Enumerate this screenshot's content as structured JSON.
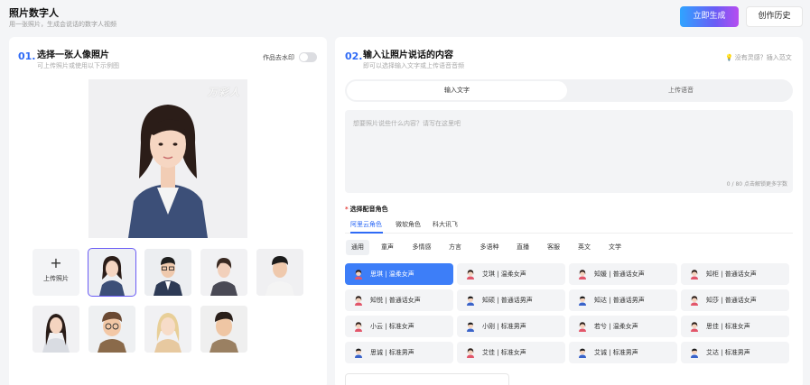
{
  "header": {
    "title": "照片数字人",
    "subtitle": "用一张照片，生成会说话的数字人视频",
    "generate_button": "立即生成",
    "history_button": "创作历史"
  },
  "left": {
    "num": "01.",
    "title": "选择一张人像照片",
    "subtitle": "可上传照片或使用以下示例图",
    "watermark_toggle_label": "作品去水印",
    "watermark_on": false,
    "preview_watermark": "万彩人",
    "upload_label": "上传照片",
    "upload_plus": "+"
  },
  "right": {
    "num": "02.",
    "title": "输入让照片说话的内容",
    "subtitle": "即可以选择输入文字或上传语音音频",
    "inspiration": "没有灵感？插入范文",
    "tabs": [
      "输入文字",
      "上传语音"
    ],
    "textarea_placeholder": "想要照片说些什么内容？请写在这里吧",
    "char_counter": "0 / 80 点击解锁更多字数",
    "voice_title": "选择配音角色",
    "required_mark": "*",
    "voice_tabs": [
      "阿里云角色",
      "微软角色",
      "科大讯飞"
    ],
    "categories": [
      "通用",
      "童声",
      "多情感",
      "方言",
      "多语种",
      "直播",
      "客服",
      "英文",
      "文学"
    ],
    "voices": [
      "思琪 | 温柔女声",
      "艾琪 | 温柔女声",
      "知媛 | 普通话女声",
      "知柜 | 普通话女声",
      "知悦 | 普通话女声",
      "知硕 | 普通话男声",
      "知达 | 普通话男声",
      "知莎 | 普通话女声",
      "小云 | 标准女声",
      "小刚 | 标准男声",
      "若兮 | 温柔女声",
      "思佳 | 标准女声",
      "思诚 | 标准男声",
      "艾佳 | 标准女声",
      "艾诚 | 标准男声",
      "艾达 | 标准男声"
    ],
    "voice_genders": [
      "f",
      "f",
      "f",
      "f",
      "f",
      "m",
      "m",
      "f",
      "f",
      "m",
      "f",
      "f",
      "m",
      "f",
      "m",
      "m"
    ]
  }
}
